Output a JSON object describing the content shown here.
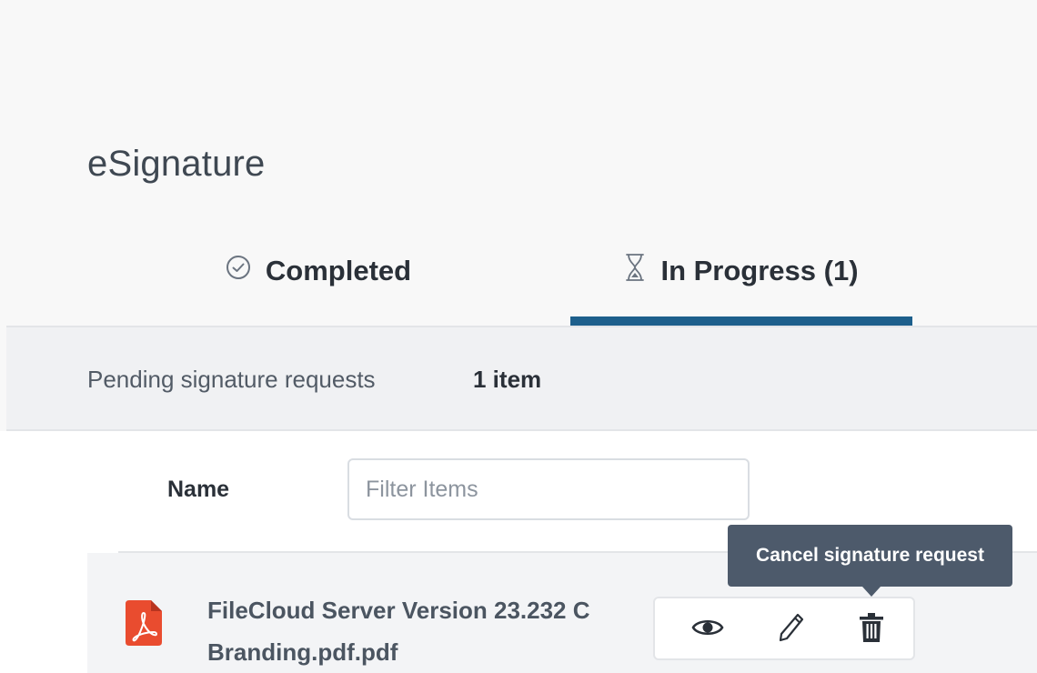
{
  "page": {
    "title": "eSignature"
  },
  "tabs": [
    {
      "label": "Completed",
      "icon": "check-circle-icon"
    },
    {
      "label": "In Progress (1)",
      "icon": "hourglass-icon",
      "active": true
    }
  ],
  "pending": {
    "label": "Pending signature requests",
    "count": "1 item"
  },
  "list": {
    "name_header": "Name",
    "filter_placeholder": "Filter Items",
    "filter_value": "",
    "items": [
      {
        "name": "FileCloud Server Version 23.232 C",
        "name_line2": "Branding.pdf.pdf",
        "icon": "pdf-file-icon",
        "actions": [
          "eye-icon",
          "pencil-icon",
          "trash-icon"
        ]
      }
    ]
  },
  "tooltip": {
    "text": "Cancel signature request"
  },
  "colors": {
    "accent": "#1d5f8c",
    "pdf_red": "#e94c2f",
    "tooltip_bg": "#4d5a6b"
  }
}
